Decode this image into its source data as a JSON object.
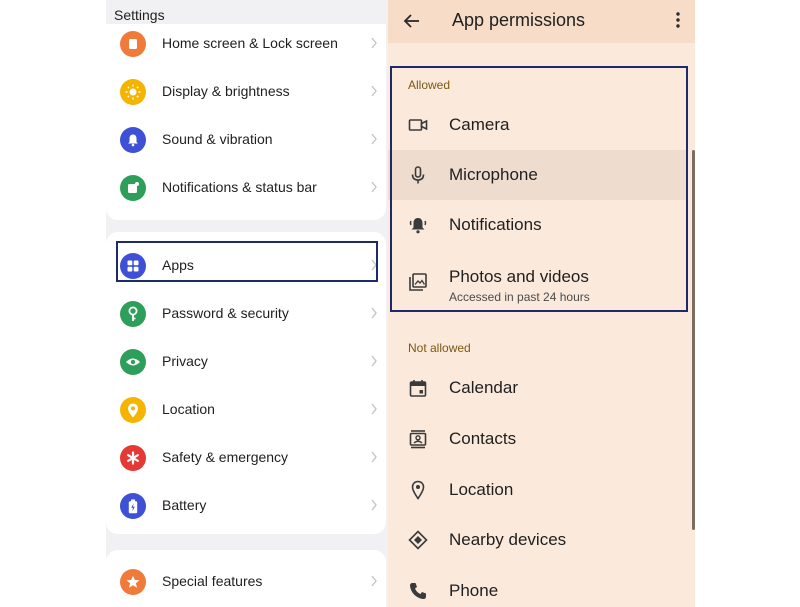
{
  "settings": {
    "title": "Settings",
    "group1": [
      {
        "label": "Home screen & Lock screen",
        "icon": "home-lock-icon",
        "color": "#f07a3a"
      },
      {
        "label": "Display & brightness",
        "icon": "sun-icon",
        "color": "#f4b400"
      },
      {
        "label": "Sound & vibration",
        "icon": "bell-icon",
        "color": "#3d50d6"
      },
      {
        "label": "Notifications & status bar",
        "icon": "notification-icon",
        "color": "#2e9e5b"
      }
    ],
    "group2": [
      {
        "label": "Apps",
        "icon": "apps-grid-icon",
        "color": "#3d50d6"
      },
      {
        "label": "Password & security",
        "icon": "key-icon",
        "color": "#2e9e5b"
      },
      {
        "label": "Privacy",
        "icon": "eye-icon",
        "color": "#2e9e5b"
      },
      {
        "label": "Location",
        "icon": "location-pin-icon",
        "color": "#f4b400"
      },
      {
        "label": "Safety & emergency",
        "icon": "asterisk-icon",
        "color": "#e53935"
      },
      {
        "label": "Battery",
        "icon": "battery-icon",
        "color": "#3d50d6"
      }
    ],
    "group3": [
      {
        "label": "Special features",
        "icon": "star-icon",
        "color": "#f07a3a"
      }
    ]
  },
  "permissions": {
    "title": "App permissions",
    "allowed_heading": "Allowed",
    "not_allowed_heading": "Not allowed",
    "allowed": [
      {
        "label": "Camera",
        "icon": "camera-icon"
      },
      {
        "label": "Microphone",
        "icon": "microphone-icon"
      },
      {
        "label": "Notifications",
        "icon": "bell-ring-icon"
      },
      {
        "label": "Photos and videos",
        "icon": "photos-icon",
        "sub": "Accessed in past 24 hours"
      }
    ],
    "not_allowed": [
      {
        "label": "Calendar",
        "icon": "calendar-icon"
      },
      {
        "label": "Contacts",
        "icon": "contacts-icon"
      },
      {
        "label": "Location",
        "icon": "location-icon"
      },
      {
        "label": "Nearby devices",
        "icon": "nearby-devices-icon"
      },
      {
        "label": "Phone",
        "icon": "phone-icon"
      }
    ]
  },
  "colors": {
    "highlight_border": "#1f2a6b",
    "permissions_bg": "#fbe9dc",
    "permissions_header_bg": "#f7dcc7",
    "section_heading": "#7a5a12"
  }
}
